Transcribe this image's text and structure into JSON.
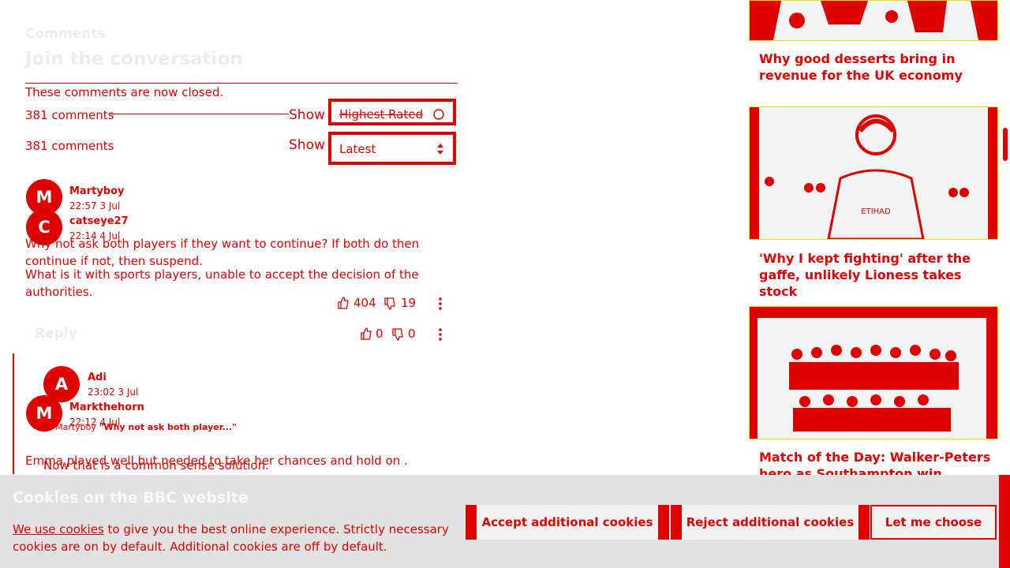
{
  "comments": {
    "header": "Comments",
    "title": "Join the conversation",
    "closed_notice": "These comments are now closed.",
    "count_a": "381 comments",
    "count_b": "381 comments",
    "show_label_a": "Show",
    "show_label_b": "Show",
    "sort_a": "Highest Rated",
    "sort_b": "Latest",
    "items": [
      {
        "avatar": "M",
        "user": "Martyboy",
        "time": "22:57 3 Jul",
        "body": "Why not ask both players if they want to continue? If both do then continue if not, then suspend.",
        "up": "404",
        "down": "19"
      },
      {
        "avatar": "C",
        "user": "catseye27",
        "time": "22:14 4 Jul",
        "body": "What is it with sports players, unable to accept the decision of the authorities.",
        "up": "0",
        "down": "0"
      }
    ],
    "reply_label": "Reply",
    "replies": [
      {
        "avatar": "A",
        "user": "Adi",
        "time": "23:02 3 Jul",
        "quote_prefix": "To Martyboy",
        "quote": "\"Why not ask both player...\"",
        "body": "Now that is a common sense solution."
      },
      {
        "avatar": "M",
        "user": "Markthehorn",
        "time": "22:12 4 Jul",
        "body": "Emma played well but needed  to take her chances and hold on ."
      }
    ]
  },
  "sidebar": {
    "captions": [
      "Why good desserts bring in revenue for the UK economy",
      "'Why I kept fighting' after the gaffe, unlikely Lioness takes stock",
      "Match of the Day: Walker-Peters hero as Southampton win"
    ]
  },
  "cookies": {
    "title": "Cookies on the BBC website",
    "link": "We use cookies",
    "text": " to give you the best online experience. Strictly necessary cookies are on by default. Additional cookies are off by default.",
    "accept": "Accept additional cookies",
    "reject": "Reject additional cookies",
    "choose": "Let me choose"
  },
  "icons": {
    "thumbs_up": "thumbs-up-icon",
    "thumbs_down": "thumbs-down-icon",
    "more": "more-vertical-icon",
    "updown": "select-arrows-icon",
    "refresh": "refresh-icon"
  },
  "colors": {
    "accent": "#e00000",
    "banner": "#e2e2e2",
    "highlight": "#f3e600"
  }
}
